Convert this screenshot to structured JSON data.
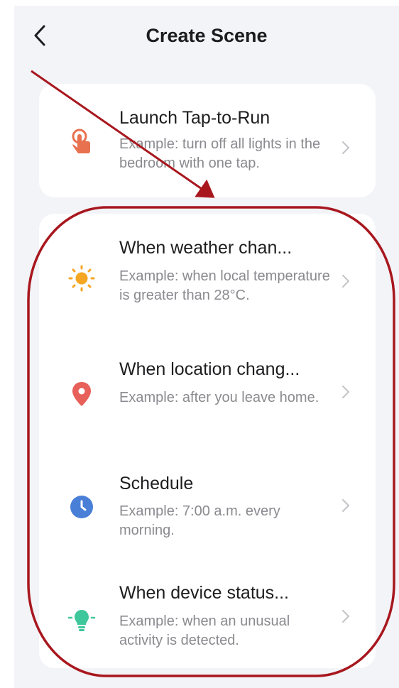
{
  "header": {
    "title": "Create Scene",
    "back_icon": "chevron-left-icon"
  },
  "tap_to_run": {
    "name": "Launch Tap-to-Run",
    "description": "Example: turn off all lights in the bedroom with one tap.",
    "icon": "tap-hand-icon"
  },
  "conditions": [
    {
      "name": "When weather chan...",
      "description": "Example: when local temperature is greater than 28°C.",
      "icon": "sun-icon"
    },
    {
      "name": "When location chang...",
      "description": "Example: after you leave home.",
      "icon": "location-pin-icon"
    },
    {
      "name": "Schedule",
      "description": "Example: 7:00 a.m. every morning.",
      "icon": "clock-icon"
    },
    {
      "name": "When device status...",
      "description": "Example: when an unusual activity is detected.",
      "icon": "device-bulb-icon"
    }
  ],
  "colors": {
    "tap": "#e8714f",
    "sun": "#f5a623",
    "location": "#e8605a",
    "clock": "#4a7fd8",
    "device": "#3ec79a",
    "annotation": "#a8171e"
  }
}
